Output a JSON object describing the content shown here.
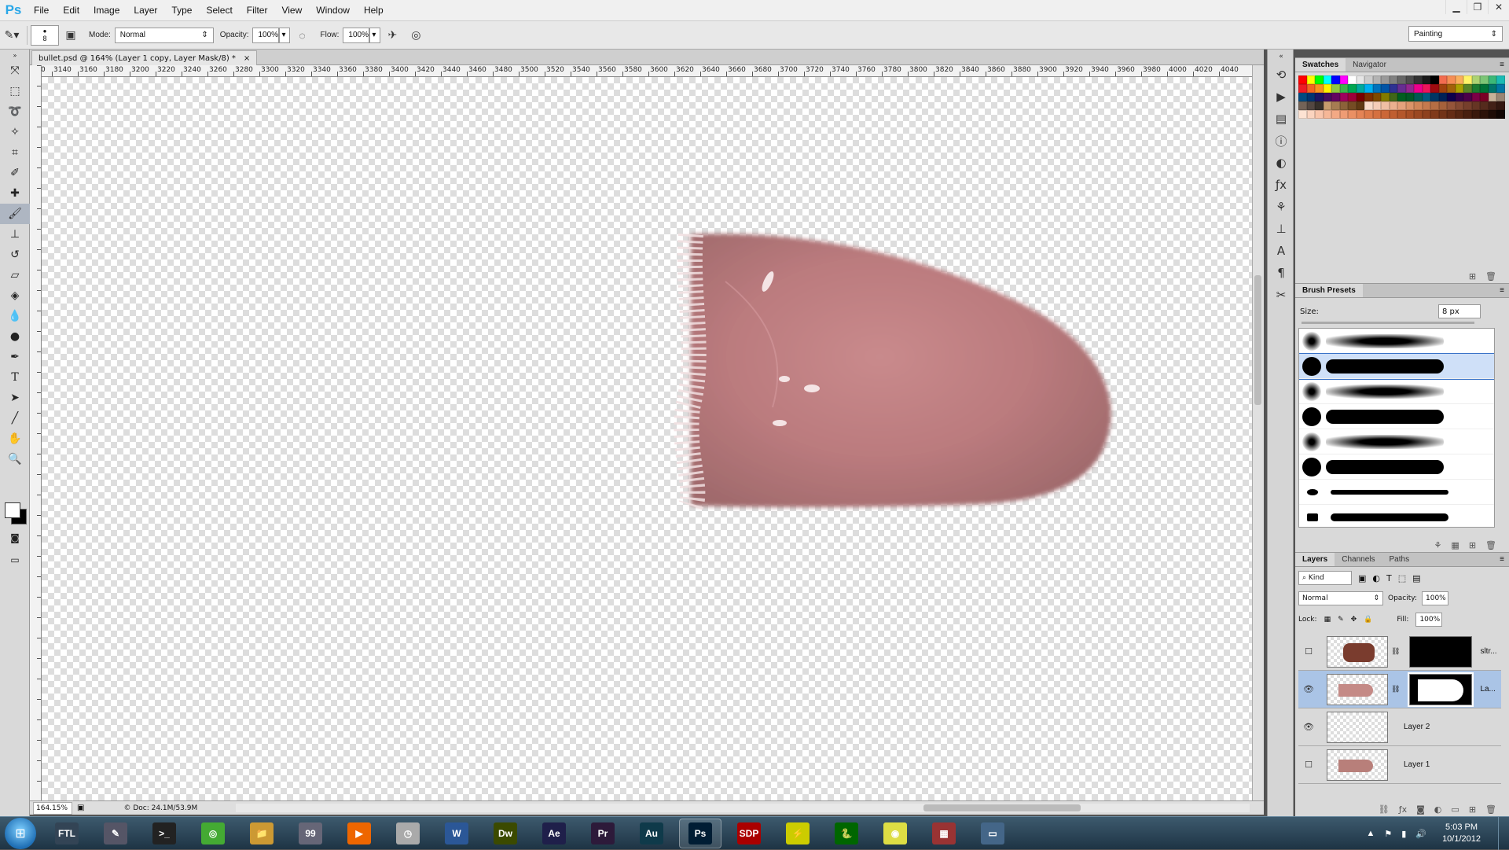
{
  "app": {
    "logo": "Ps"
  },
  "menu": [
    "File",
    "Edit",
    "Image",
    "Layer",
    "Type",
    "Select",
    "Filter",
    "View",
    "Window",
    "Help"
  ],
  "window_controls": {
    "minimize": "▁",
    "restore": "❐",
    "close": "✕"
  },
  "options_bar": {
    "brush_size": "8",
    "mode_label": "Mode:",
    "mode_value": "Normal",
    "opacity_label": "Opacity:",
    "opacity_value": "100%",
    "flow_label": "Flow:",
    "flow_value": "100%",
    "workspace": "Painting"
  },
  "document": {
    "tab_title": "bullet.psd @ 164% (Layer 1 copy, Layer Mask/8) *",
    "tab_close": "×",
    "ruler_h": [
      "0",
      "3140",
      "3160",
      "3180",
      "3200",
      "3220",
      "3240",
      "3260",
      "3280",
      "3300",
      "3320",
      "3340",
      "3360",
      "3380",
      "3400",
      "3420",
      "3440",
      "3460",
      "3480",
      "3500",
      "3520",
      "3540",
      "3560",
      "3580",
      "3600",
      "3620",
      "3640",
      "3660",
      "3680",
      "3700",
      "3720",
      "3740",
      "3760",
      "3780",
      "3800",
      "3820",
      "3840",
      "3860",
      "3880",
      "3900",
      "3920",
      "3940",
      "3960",
      "3980",
      "4000",
      "4020",
      "4040"
    ],
    "zoom": "164.15%",
    "doc_info": "Doc: 24.1M/53.9M"
  },
  "panels": {
    "swatches": {
      "tabs": [
        "Swatches",
        "Navigator"
      ]
    },
    "brush_presets": {
      "title": "Brush Presets",
      "size_label": "Size:",
      "size_value": "8 px"
    },
    "layers": {
      "tabs": [
        "Layers",
        "Channels",
        "Paths"
      ],
      "kind_label": "Kind",
      "blend_mode": "Normal",
      "opacity_label": "Opacity:",
      "opacity_value": "100%",
      "lock_label": "Lock:",
      "fill_label": "Fill:",
      "fill_value": "100%",
      "items": [
        {
          "name": "sltr...",
          "visible": false
        },
        {
          "name": "La...",
          "visible": true
        },
        {
          "name": "Layer 2",
          "visible": true
        },
        {
          "name": "Layer 1",
          "visible": false
        }
      ]
    }
  },
  "taskbar": {
    "apps": [
      "FTL",
      "✎",
      ">_",
      "◎",
      "📁",
      "99",
      "▶",
      "◷",
      "W",
      "Dw",
      "Ae",
      "Pr",
      "Au",
      "Ps",
      "SDP",
      "⚡",
      "🐍",
      "◉",
      "▦",
      "▭"
    ],
    "clock_time": "5:03 PM",
    "clock_date": "10/1/2012"
  },
  "colors": {
    "ps_blue": "#2aa7e8",
    "selected_layer": "#aac4e6",
    "taskbar": "#2a4556"
  }
}
